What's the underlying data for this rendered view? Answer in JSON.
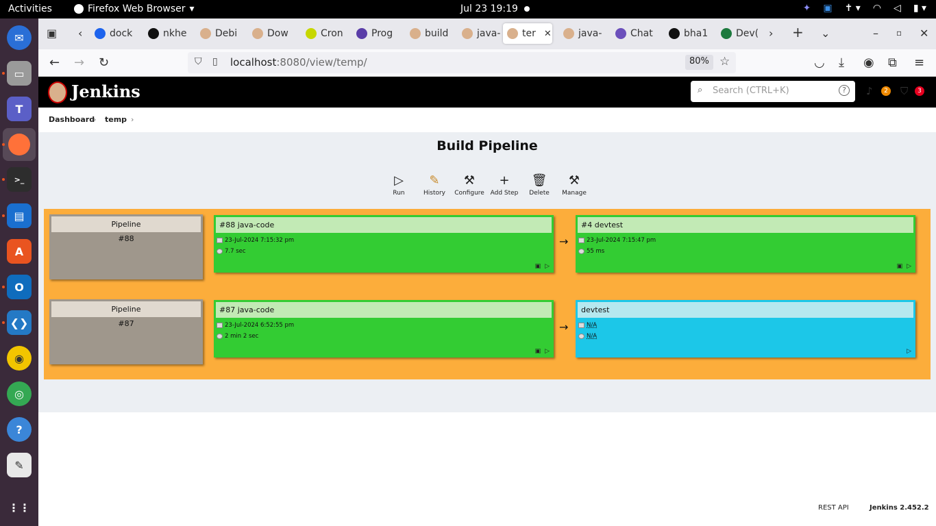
{
  "os": {
    "activities": "Activities",
    "app_name": "Firefox Web Browser",
    "clock": "Jul 23  19:19"
  },
  "browser": {
    "tabs": [
      {
        "label": "dock",
        "color": "#1d63ed"
      },
      {
        "label": "nkhe",
        "color": "#111111"
      },
      {
        "label": "Debi",
        "color": "#d9b08c"
      },
      {
        "label": "Dow",
        "color": "#d9b08c"
      },
      {
        "label": "Cron",
        "color": "#c7d700"
      },
      {
        "label": "Prog",
        "color": "#5a3da8"
      },
      {
        "label": "build",
        "color": "#d9b08c"
      },
      {
        "label": "java-",
        "color": "#d9b08c"
      },
      {
        "label": "ter",
        "color": "#d9b08c",
        "active": true
      },
      {
        "label": "java-",
        "color": "#d9b08c"
      },
      {
        "label": "Chat",
        "color": "#6b4fbb"
      },
      {
        "label": "bha1",
        "color": "#111111"
      },
      {
        "label": "Dev(",
        "color": "#1d7a3e"
      }
    ],
    "url_host": "localhost",
    "url_rest": ":8080/view/temp/",
    "zoom": "80%"
  },
  "jenkins": {
    "title": "Jenkins",
    "search_placeholder": "Search (CTRL+K)",
    "notif_count": "2",
    "security_count": "3",
    "breadcrumbs": [
      "Dashboard",
      "temp"
    ],
    "page_title": "Build Pipeline",
    "tools": [
      {
        "label": "Run",
        "icon": "play-icon"
      },
      {
        "label": "History",
        "icon": "notepad-icon"
      },
      {
        "label": "Configure",
        "icon": "wrench-icon"
      },
      {
        "label": "Add Step",
        "icon": "plus-icon"
      },
      {
        "label": "Delete",
        "icon": "trash-icon"
      },
      {
        "label": "Manage",
        "icon": "wrench-icon"
      }
    ],
    "rows": [
      {
        "pipeline_label": "Pipeline",
        "pipeline_num": "#88",
        "build1": {
          "title": "#88 java-code",
          "date": "23-Jul-2024 7:15:32 pm",
          "duration": "7.7 sec"
        },
        "build2": {
          "title": "#4 devtest",
          "date": "23-Jul-2024 7:15:47 pm",
          "duration": "55 ms"
        }
      },
      {
        "pipeline_label": "Pipeline",
        "pipeline_num": "#87",
        "build1": {
          "title": "#87 java-code",
          "date": "23-Jul-2024 6:52:55 pm",
          "duration": "2 min 2 sec"
        },
        "build2": {
          "title": "devtest",
          "date": "N/A",
          "duration": "N/A"
        }
      }
    ],
    "footer": {
      "rest_api": "REST API",
      "version": "Jenkins 2.452.2"
    },
    "colors": {
      "success": "#33cc33",
      "pending": "#1cc7e8",
      "pipeline_bg": "#fcad3b"
    }
  }
}
